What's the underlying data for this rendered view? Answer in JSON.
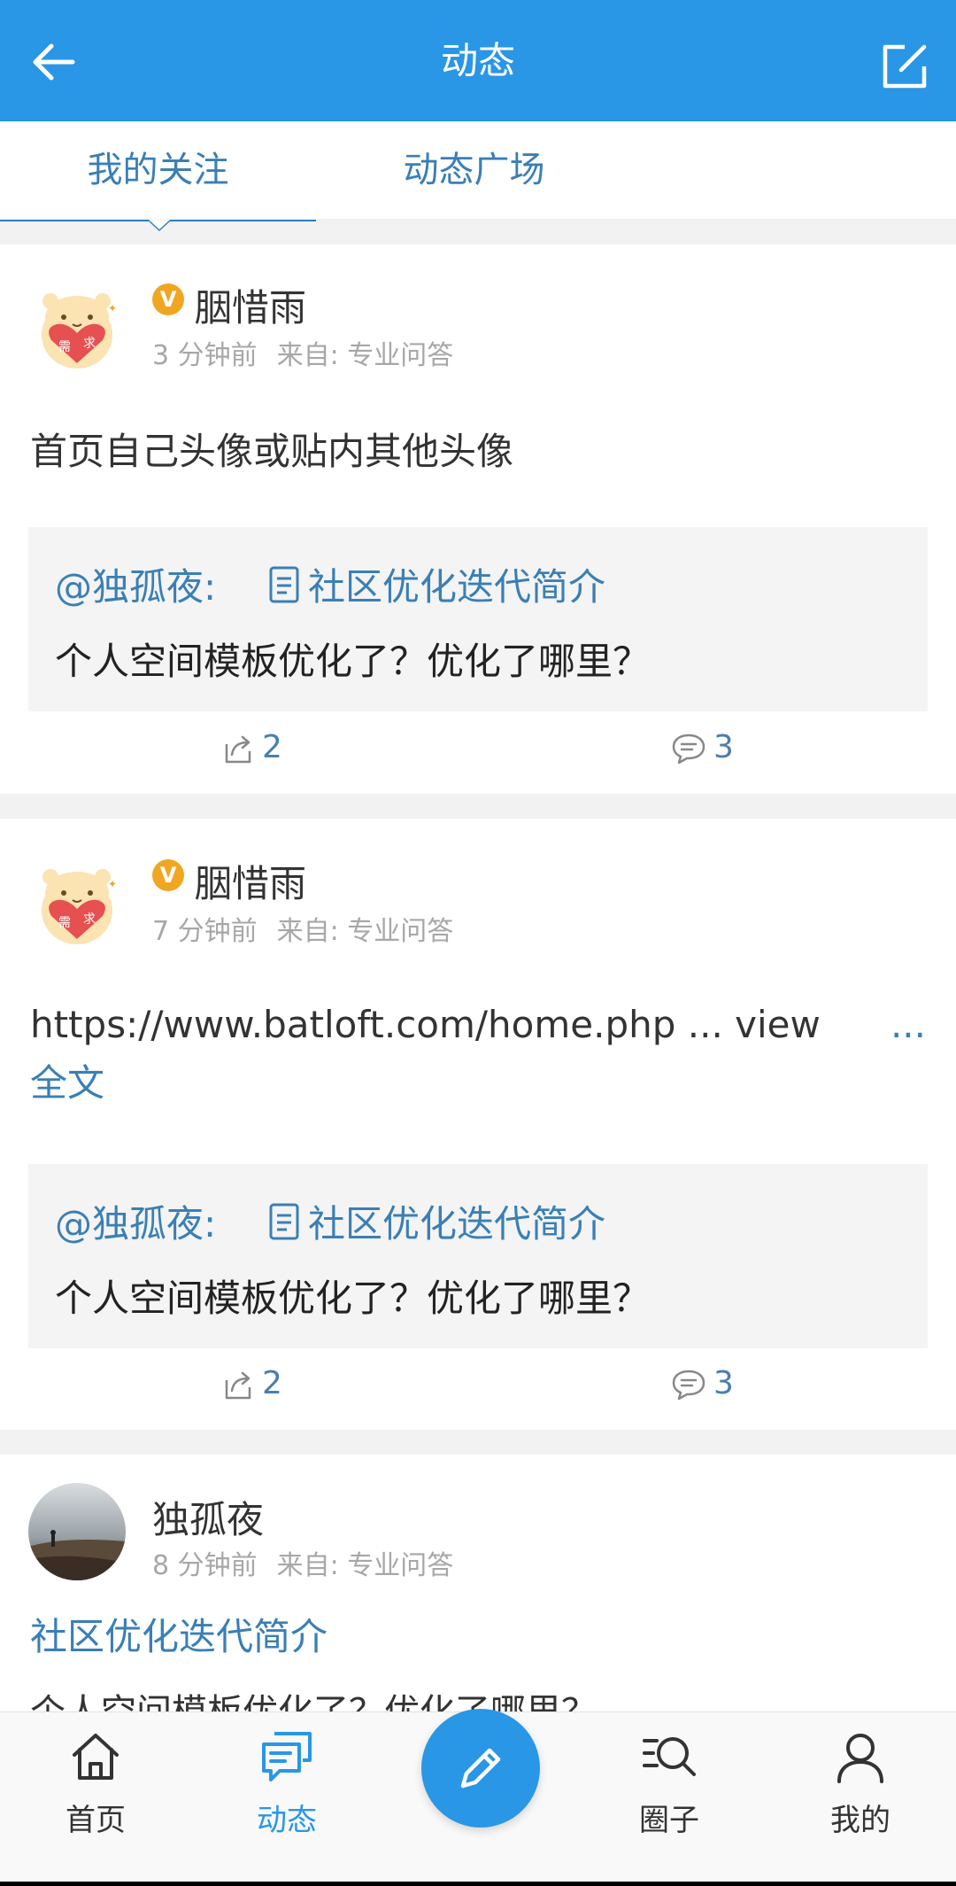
{
  "header": {
    "title": "动态",
    "back_icon": "arrow-left-icon",
    "compose_icon": "edit-square-icon"
  },
  "tabs": [
    {
      "label": "我的关注",
      "active": true
    },
    {
      "label": "动态广场",
      "active": false
    }
  ],
  "posts": [
    {
      "user": "胭惜雨",
      "verified": "V",
      "time": "3 分钟前",
      "source": "来自: 专业问答",
      "content": "首页自己头像或贴内其他头像",
      "quote": {
        "author": "@独孤夜:",
        "title": "社区优化迭代简介",
        "body": "个人空间模板优化了？优化了哪里？"
      },
      "shares": "2",
      "comments": "3"
    },
    {
      "user": "胭惜雨",
      "verified": "V",
      "time": "7 分钟前",
      "source": "来自: 专业问答",
      "content": "https://www.batloft.com/home.php ... view",
      "more": "...",
      "more_label": "全文",
      "quote": {
        "author": "@独孤夜:",
        "title": "社区优化迭代简介",
        "body": "个人空间模板优化了？优化了哪里？"
      },
      "shares": "2",
      "comments": "3"
    },
    {
      "user": "独孤夜",
      "time": "8 分钟前",
      "source": "来自: 专业问答",
      "title": "社区优化迭代简介",
      "body": "个人空间模板优化了？优化了哪里？"
    }
  ],
  "nav": [
    {
      "label": "首页",
      "icon": "home-icon",
      "active": false
    },
    {
      "label": "动态",
      "icon": "chat-bubbles-icon",
      "active": true
    },
    {
      "label": "圈子",
      "icon": "search-list-icon",
      "active": false
    },
    {
      "label": "我的",
      "icon": "user-icon",
      "active": false
    }
  ],
  "fab_icon": "pencil-icon",
  "colors": {
    "primary": "#2a96e6",
    "link": "#3a7fb5",
    "badge": "#f1a622"
  }
}
